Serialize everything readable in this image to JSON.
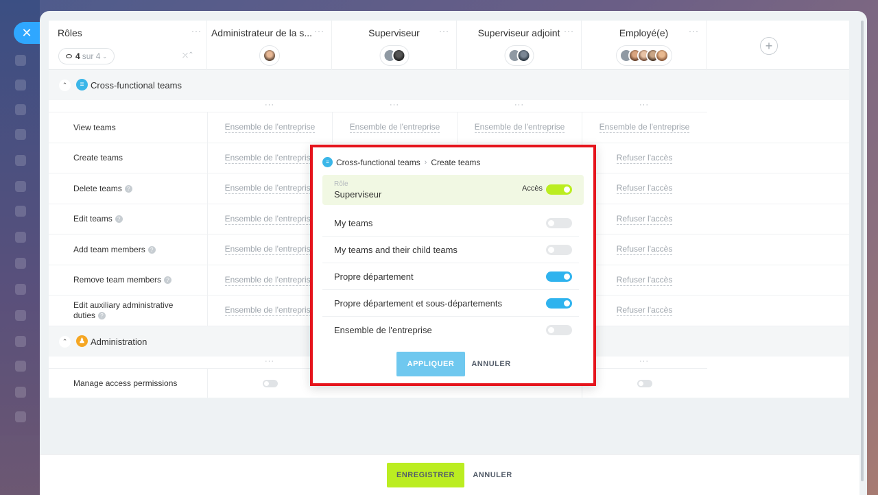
{
  "header": {
    "roles_title": "Rôles",
    "counter_count": "4",
    "counter_total": "sur 4",
    "columns": [
      {
        "title": "Administrateur de la s..."
      },
      {
        "title": "Superviseur"
      },
      {
        "title": "Superviseur adjoint"
      },
      {
        "title": "Employé(e)"
      }
    ]
  },
  "sections": [
    {
      "label": "Cross-functional teams",
      "rows": [
        {
          "label": "View teams",
          "help": false,
          "values": [
            "Ensemble de l'entreprise",
            "Ensemble de l'entreprise",
            "Ensemble de l'entreprise",
            "Ensemble de l'entreprise"
          ]
        },
        {
          "label": "Create teams",
          "help": false,
          "values": [
            "Ensemble de l'entreprise",
            "",
            "",
            "Refuser l'accès"
          ]
        },
        {
          "label": "Delete teams",
          "help": true,
          "values": [
            "Ensemble de l'entreprise",
            "",
            "",
            "Refuser l'accès"
          ]
        },
        {
          "label": "Edit teams",
          "help": true,
          "values": [
            "Ensemble de l'entreprise",
            "",
            "",
            "Refuser l'accès"
          ]
        },
        {
          "label": "Add team members",
          "help": true,
          "values": [
            "Ensemble de l'entreprise",
            "",
            "",
            "Refuser l'accès"
          ]
        },
        {
          "label": "Remove team members",
          "help": true,
          "values": [
            "Ensemble de l'entreprise",
            "",
            "",
            "Refuser l'accès"
          ]
        },
        {
          "label": "Edit auxiliary administrative duties",
          "help": true,
          "values": [
            "Ensemble de l'entreprise",
            "",
            "",
            "Refuser l'accès"
          ]
        }
      ]
    },
    {
      "label": "Administration",
      "rows": [
        {
          "label": "Manage access permissions",
          "help": false
        }
      ]
    }
  ],
  "popup": {
    "breadcrumb_section": "Cross-functional teams",
    "breadcrumb_item": "Create teams",
    "role_key": "Rôle",
    "role_value": "Superviseur",
    "access_label": "Accès",
    "options": [
      {
        "label": "My teams",
        "state": "off"
      },
      {
        "label": "My teams and their child teams",
        "state": "off"
      },
      {
        "label": "Propre département",
        "state": "on"
      },
      {
        "label": "Propre département et sous-départements",
        "state": "on"
      },
      {
        "label": "Ensemble de l'entreprise",
        "state": "off"
      }
    ],
    "apply_label": "APPLIQUER",
    "cancel_label": "ANNULER"
  },
  "footer": {
    "save_label": "ENREGISTRER",
    "cancel_label": "ANNULER"
  },
  "colors": {
    "accent_green": "#bbed21",
    "accent_blue": "#2fb3ee",
    "highlight_red": "#e5141c"
  }
}
